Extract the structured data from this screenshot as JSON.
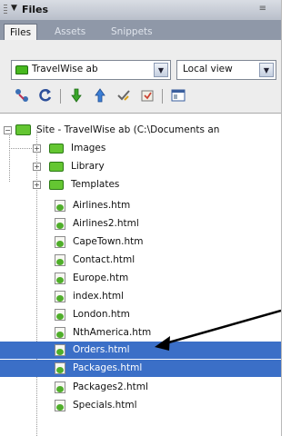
{
  "panel": {
    "title": "Files",
    "collapse_icon": "triangle-down-icon",
    "options_icon": "panel-options-icon"
  },
  "tabs": [
    {
      "label": "Files",
      "active": true
    },
    {
      "label": "Assets",
      "active": false
    },
    {
      "label": "Snippets",
      "active": false
    }
  ],
  "site_select": {
    "value": "TravelWise ab"
  },
  "view_select": {
    "value": "Local view"
  },
  "toolbar": {
    "icons": [
      "connect-icon",
      "refresh-icon",
      "get-files-icon",
      "put-files-icon",
      "check-out-icon",
      "check-in-icon",
      "expand-view-icon"
    ]
  },
  "tree": {
    "root": {
      "label": "Site - TravelWise ab (C:\\Documents an"
    },
    "folders": [
      {
        "label": "Images"
      },
      {
        "label": "Library"
      },
      {
        "label": "Templates"
      }
    ],
    "files": [
      {
        "label": "Airlines.htm",
        "selected": false
      },
      {
        "label": "Airlines2.html",
        "selected": false
      },
      {
        "label": "CapeTown.htm",
        "selected": false
      },
      {
        "label": "Contact.html",
        "selected": false
      },
      {
        "label": "Europe.htm",
        "selected": false
      },
      {
        "label": "index.html",
        "selected": false
      },
      {
        "label": "London.htm",
        "selected": false
      },
      {
        "label": "NthAmerica.htm",
        "selected": false
      },
      {
        "label": "Orders.html",
        "selected": true
      },
      {
        "label": "Packages.html",
        "selected": true
      },
      {
        "label": "Packages2.html",
        "selected": false
      },
      {
        "label": "Specials.html",
        "selected": false
      }
    ]
  },
  "colors": {
    "selection": "#3b6fc7",
    "tab_strip": "#8f98a8",
    "folder_green": "#64c632"
  }
}
